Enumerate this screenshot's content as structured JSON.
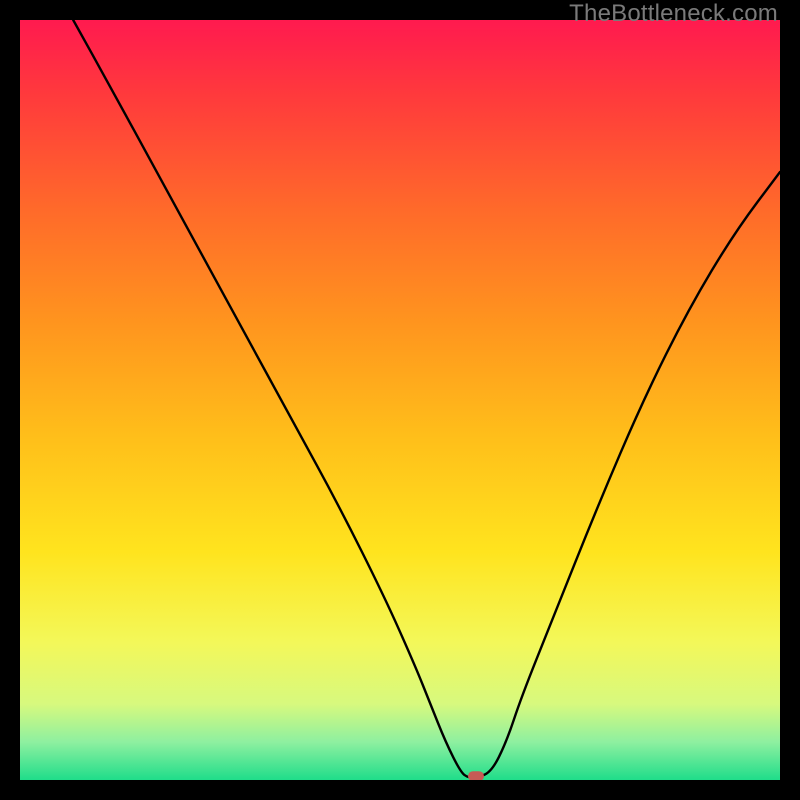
{
  "watermark": "TheBottleneck.com",
  "chart_data": {
    "type": "line",
    "title": "",
    "xlabel": "",
    "ylabel": "",
    "xlim": [
      0,
      100
    ],
    "ylim": [
      0,
      100
    ],
    "grid": false,
    "series": [
      {
        "name": "curve",
        "x": [
          7,
          12,
          18,
          24,
          30,
          36,
          42,
          48,
          52,
          54,
          56,
          58,
          59,
          60,
          62,
          64,
          66,
          70,
          76,
          82,
          88,
          94,
          100
        ],
        "values": [
          100,
          91,
          80,
          69,
          58,
          47,
          36,
          24,
          15,
          10,
          5,
          1,
          0.3,
          0.3,
          1,
          5,
          11,
          21,
          36,
          50,
          62,
          72,
          80
        ]
      }
    ],
    "flat_segment": {
      "x_start": 58.5,
      "x_end": 60.5,
      "y": 0.3
    },
    "marker": {
      "x": 60,
      "y": 0.5,
      "color": "#c65a55"
    },
    "background_gradient": {
      "stops": [
        {
          "offset": 0.0,
          "color": "#ff1a4f"
        },
        {
          "offset": 0.1,
          "color": "#ff3a3c"
        },
        {
          "offset": 0.25,
          "color": "#ff6a2a"
        },
        {
          "offset": 0.4,
          "color": "#ff951e"
        },
        {
          "offset": 0.55,
          "color": "#ffbf1a"
        },
        {
          "offset": 0.7,
          "color": "#ffe41e"
        },
        {
          "offset": 0.82,
          "color": "#f3f85a"
        },
        {
          "offset": 0.9,
          "color": "#d7f97e"
        },
        {
          "offset": 0.95,
          "color": "#8ef0a0"
        },
        {
          "offset": 1.0,
          "color": "#1fdd8a"
        }
      ]
    }
  }
}
